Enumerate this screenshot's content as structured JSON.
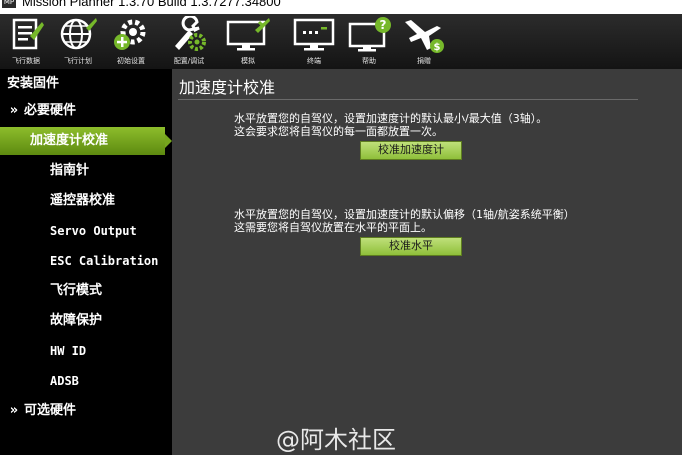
{
  "window": {
    "title": "Mission Planner 1.3.70 Build 1.3.7277.34800",
    "icon_text": "MP"
  },
  "toolbar": [
    {
      "label": "飞行数据",
      "icon": "flight-data-icon"
    },
    {
      "label": "飞行计划",
      "icon": "flight-plan-icon"
    },
    {
      "label": "初始设置",
      "icon": "initial-setup-icon"
    },
    {
      "label": "配置/调试",
      "icon": "config-tuning-icon"
    },
    {
      "label": "模拟",
      "icon": "simulation-icon"
    },
    {
      "label": "终端",
      "icon": "terminal-icon"
    },
    {
      "label": "帮助",
      "icon": "help-icon"
    },
    {
      "label": "捐赠",
      "icon": "donate-icon"
    }
  ],
  "sidebar": {
    "heading": "安装固件",
    "mandatory": {
      "chevron": "»",
      "label": "必要硬件"
    },
    "items": [
      {
        "label": "加速度计校准",
        "active": true
      },
      {
        "label": "指南针"
      },
      {
        "label": "遥控器校准"
      },
      {
        "label": "Servo Output"
      },
      {
        "label": "ESC Calibration"
      },
      {
        "label": "飞行模式"
      },
      {
        "label": "故障保护"
      },
      {
        "label": "HW ID"
      },
      {
        "label": "ADSB"
      }
    ],
    "optional": {
      "chevron": "»",
      "label": "可选硬件"
    }
  },
  "main": {
    "title": "加速度计校准",
    "section1": {
      "line1": "水平放置您的自驾仪，设置加速度计的默认最小/最大值（3轴）。",
      "line2": "这会要求您将自驾仪的每一面都放置一次。",
      "button": "校准加速度计"
    },
    "section2": {
      "line1": "水平放置您的自驾仪，设置加速度计的默认偏移（1轴/航姿系统平衡）",
      "line2": "这需要您将自驾仪放置在水平的平面上。",
      "button": "校准水平"
    }
  },
  "watermark": "@阿木社区",
  "colors": {
    "accent": "#76b82a",
    "background": "#3c3c3c",
    "sidebar": "#000000"
  }
}
